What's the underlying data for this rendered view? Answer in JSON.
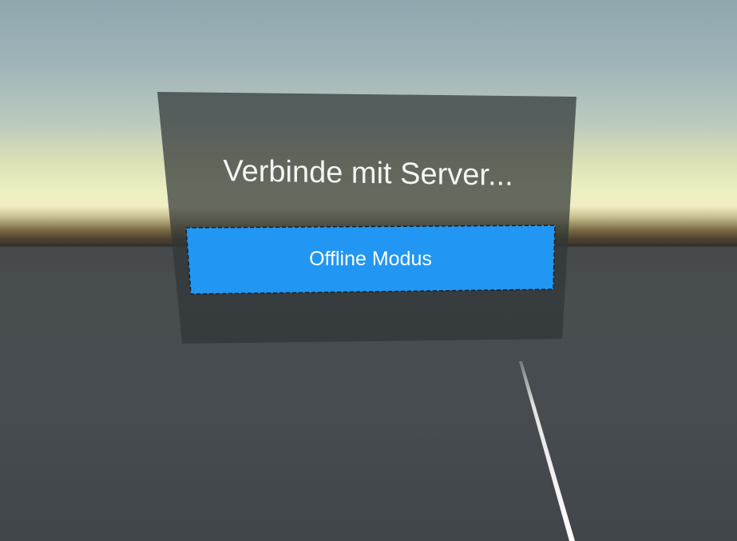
{
  "dialog": {
    "title": "Verbinde mit Server...",
    "offline_button_label": "Offline Modus"
  },
  "colors": {
    "panel": "#3c4446",
    "button": "#2196f3",
    "button_text": "#ffffff",
    "title_text": "#f4f4f4"
  }
}
